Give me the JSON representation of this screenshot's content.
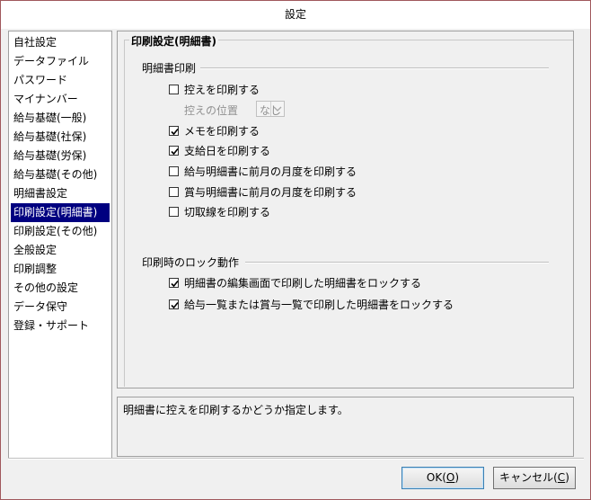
{
  "window": {
    "title": "設定"
  },
  "sidebar": {
    "items": [
      {
        "label": "自社設定"
      },
      {
        "label": "データファイル"
      },
      {
        "label": "パスワード"
      },
      {
        "label": "マイナンバー"
      },
      {
        "label": "給与基礎(一般)"
      },
      {
        "label": "給与基礎(社保)"
      },
      {
        "label": "給与基礎(労保)"
      },
      {
        "label": "給与基礎(その他)"
      },
      {
        "label": "明細書設定"
      },
      {
        "label": "印刷設定(明細書)",
        "selected": true
      },
      {
        "label": "印刷設定(その他)"
      },
      {
        "label": "全般設定"
      },
      {
        "label": "印刷調整"
      },
      {
        "label": "その他の設定"
      },
      {
        "label": "データ保守"
      },
      {
        "label": "登録・サポート"
      }
    ]
  },
  "main": {
    "group_title": "印刷設定(明細書)",
    "section1": {
      "label": "明細書印刷",
      "options": [
        {
          "label": "控えを印刷する",
          "checked": false
        },
        {
          "label": "メモを印刷する",
          "checked": true
        },
        {
          "label": "支給日を印刷する",
          "checked": true
        },
        {
          "label": "給与明細書に前月の月度を印刷する",
          "checked": false
        },
        {
          "label": "賞与明細書に前月の月度を印刷する",
          "checked": false
        },
        {
          "label": "切取線を印刷する",
          "checked": false
        }
      ],
      "copy_position": {
        "label": "控えの位置",
        "value": "なし",
        "disabled": true
      }
    },
    "section2": {
      "label": "印刷時のロック動作",
      "options": [
        {
          "label": "明細書の編集画面で印刷した明細書をロックする",
          "checked": true
        },
        {
          "label": "給与一覧または賞与一覧で印刷した明細書をロックする",
          "checked": true
        }
      ]
    }
  },
  "description": "明細書に控えを印刷するかどうか指定します。",
  "footer": {
    "ok": {
      "text": "OK(",
      "key": "O",
      "close": ")"
    },
    "cancel": {
      "text": "キャンセル(",
      "key": "C",
      "close": ")"
    }
  },
  "colors": {
    "selection": "#000080",
    "window_border": "#a0585c"
  }
}
